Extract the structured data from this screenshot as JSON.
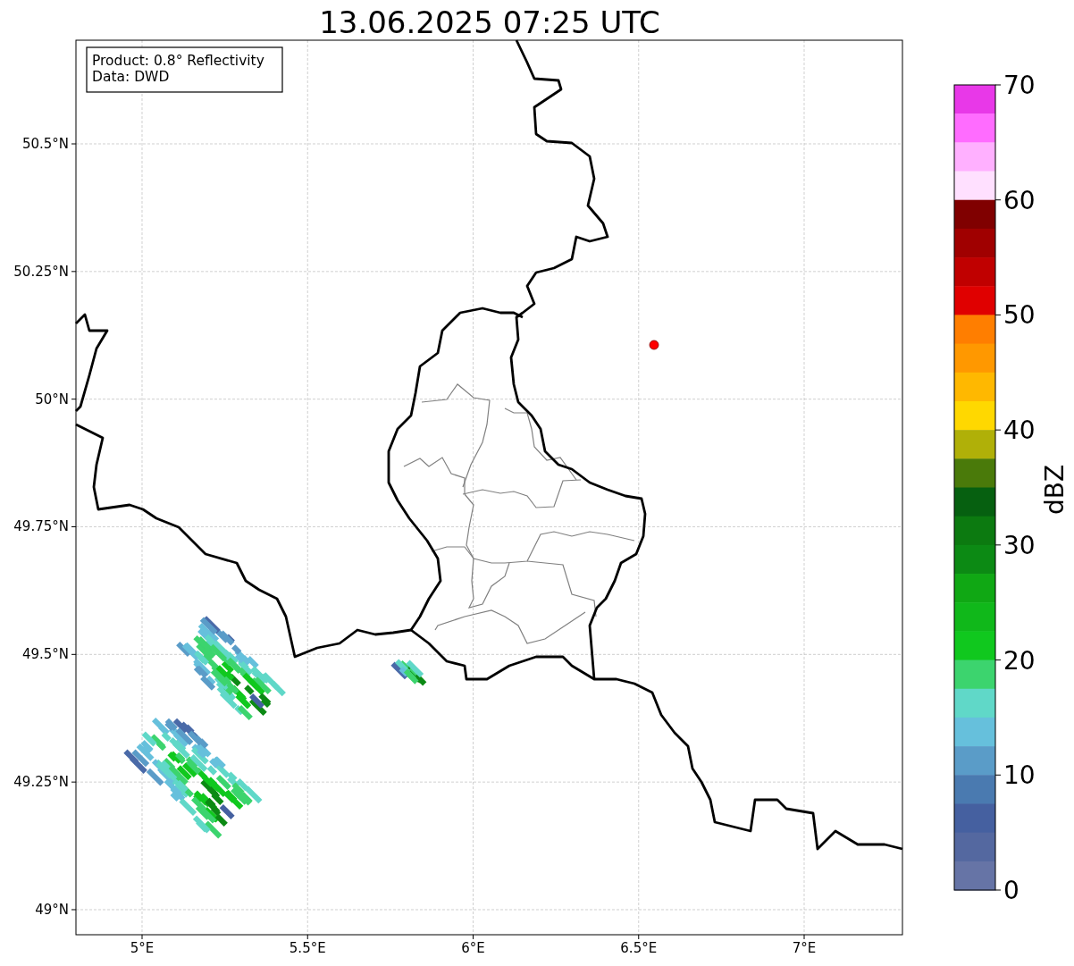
{
  "title": "13.06.2025 07:25 UTC",
  "info_box": [
    "Product: 0.8° Reflectivity",
    "Data: DWD"
  ],
  "x_ticks": [
    "5°E",
    "5.5°E",
    "6°E",
    "6.5°E",
    "7°E"
  ],
  "y_ticks": [
    "50.5°N",
    "50.25°N",
    "50°N",
    "49.75°N",
    "49.5°N",
    "49.25°N",
    "49°N"
  ],
  "colorbar": {
    "label": "dBZ",
    "ticks": [
      "70",
      "60",
      "50",
      "40",
      "30",
      "20",
      "10",
      "0"
    ],
    "bands": [
      {
        "color": "#e838e8"
      },
      {
        "color": "#ff6cff"
      },
      {
        "color": "#ffb0ff"
      },
      {
        "color": "#ffe0ff"
      },
      {
        "color": "#800000"
      },
      {
        "color": "#a00000"
      },
      {
        "color": "#c00000"
      },
      {
        "color": "#e00000"
      },
      {
        "color": "#ff7e00"
      },
      {
        "color": "#ff9800"
      },
      {
        "color": "#ffb800"
      },
      {
        "color": "#ffd800"
      },
      {
        "color": "#b0b008"
      },
      {
        "color": "#4a7a0a"
      },
      {
        "color": "#066010"
      },
      {
        "color": "#0c7a10"
      },
      {
        "color": "#0c8a14"
      },
      {
        "color": "#10a814"
      },
      {
        "color": "#10b81a"
      },
      {
        "color": "#10c81e"
      },
      {
        "color": "#3cd46e"
      },
      {
        "color": "#60d8c8"
      },
      {
        "color": "#66c0dc"
      },
      {
        "color": "#5a9cc8"
      },
      {
        "color": "#4a7ab0"
      },
      {
        "color": "#4560a0"
      },
      {
        "color": "#5468a0"
      },
      {
        "color": "#6674a6"
      }
    ]
  }
}
